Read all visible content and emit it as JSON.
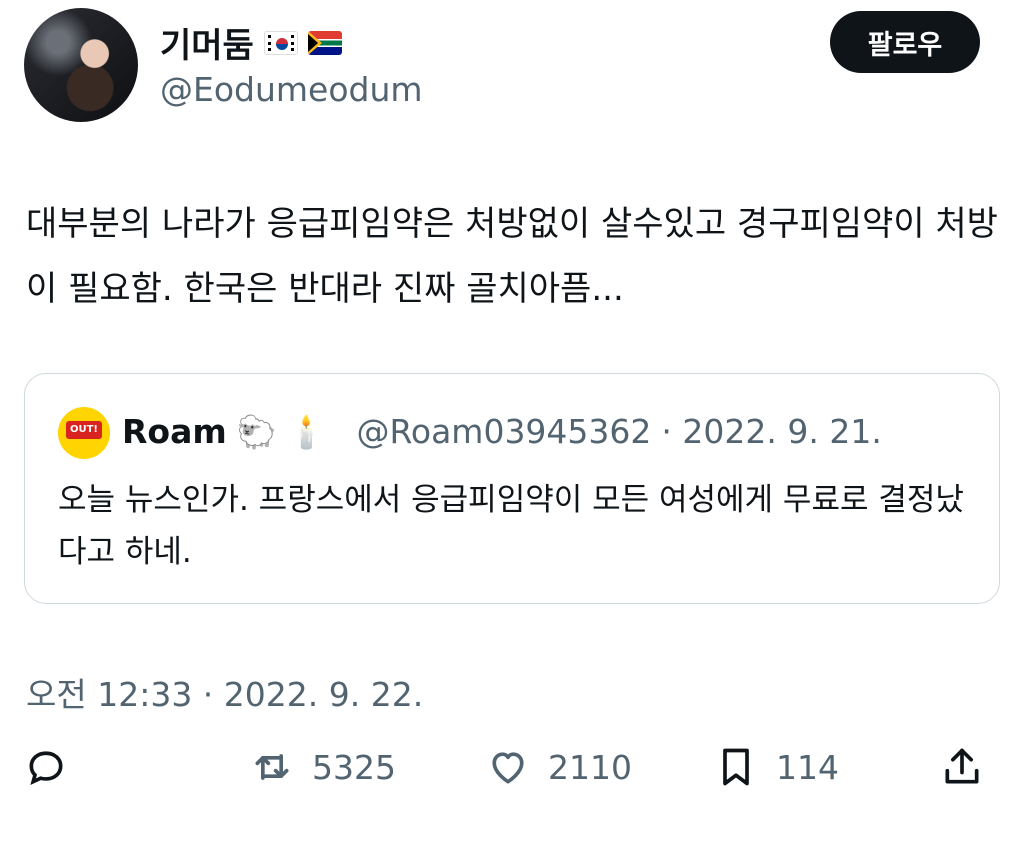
{
  "author": {
    "display_name": "기머둠",
    "flags": [
      "🇰🇷",
      "🇿🇦"
    ],
    "handle": "@Eodumeodum"
  },
  "follow_label": "팔로우",
  "tweet_text": "대부분의 나라가 응급피임약은 처방없이 살수있고 경구피임약이 처방이 필요함. 한국은 반대라 진짜 골치아픔...",
  "quote": {
    "avatar_sign": "OUT!",
    "name": "Roam",
    "name_emojis": [
      "🐑",
      "🕯️"
    ],
    "handle": "@Roam03945362",
    "date": "· 2022. 9. 21.",
    "text": "오늘 뉴스인가. 프랑스에서 응급피임약이 모든 여성에게 무료로 결정났다고 하네."
  },
  "timestamp": "오전 12:33 · 2022. 9. 22.",
  "actions": {
    "reply_icon": "reply-icon",
    "retweet_count": "5325",
    "like_count": "2110",
    "bookmark_count": "114",
    "share_icon": "share-icon"
  }
}
